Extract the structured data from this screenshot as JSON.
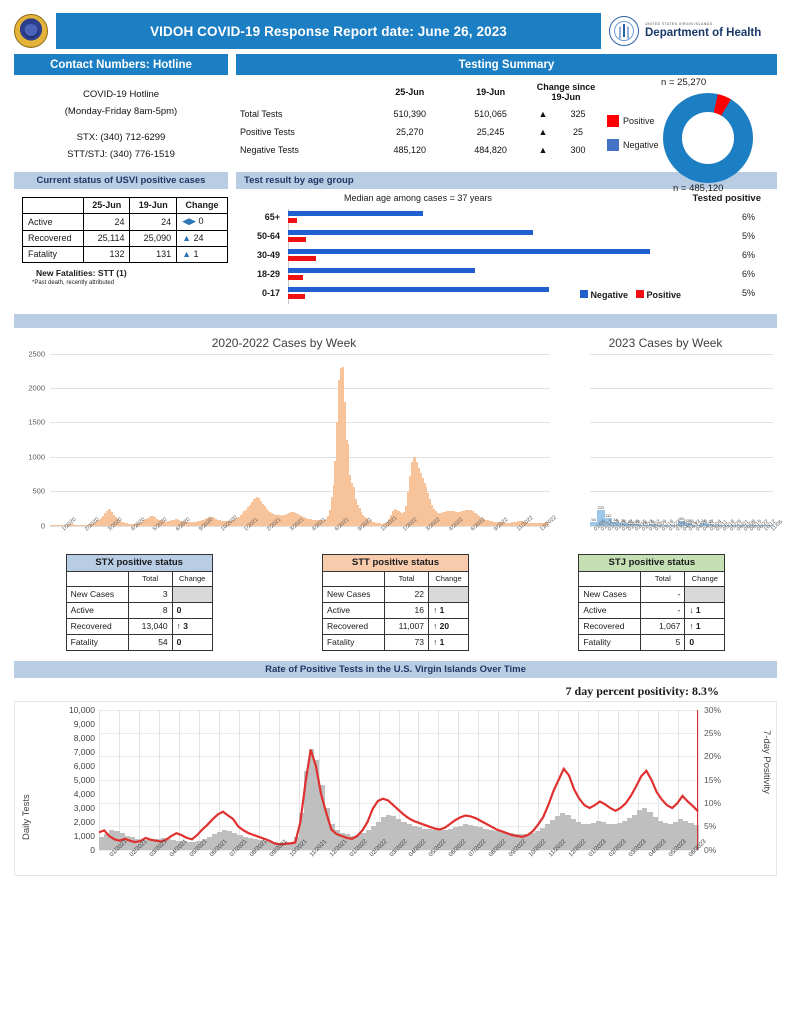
{
  "header": {
    "title": "VIDOH COVID-19 Response Report date: June 26, 2023",
    "logo_small": "UNITED STATES VIRGIN ISLANDS",
    "logo_big": "Department of Health",
    "accent_blue": "#1d7fc3"
  },
  "contact": {
    "heading": "Contact Numbers: Hotline",
    "line1": "COVID-19 Hotline",
    "line2": "(Monday-Friday 8am-5pm)",
    "line3": "STX: (340) 712-6299",
    "line4": "STT/STJ: (340) 776-1519"
  },
  "testing": {
    "heading": "Testing Summary",
    "columns": [
      "",
      "25-Jun",
      "19-Jun",
      "Change since 19-Jun"
    ],
    "rows": [
      {
        "label": "Total Tests",
        "current": "510,390",
        "previous": "510,065",
        "arrow": "▲",
        "change": "325"
      },
      {
        "label": "Positive Tests",
        "current": "25,270",
        "previous": "25,245",
        "arrow": "▲",
        "change": "25"
      },
      {
        "label": "Negative Tests",
        "current": "485,120",
        "previous": "484,820",
        "arrow": "▲",
        "change": "300"
      }
    ],
    "donut": {
      "label_top": "n =  25,270",
      "label_bottom": "n =  485,120",
      "legend": [
        {
          "name": "Positive",
          "color": "#ff0000"
        },
        {
          "name": "Negative",
          "color": "#4472c4"
        }
      ],
      "positive_value": 25270,
      "negative_value": 485120
    }
  },
  "status": {
    "heading": "Current status of USVI positive cases",
    "columns": [
      "",
      "25-Jun",
      "19-Jun",
      "Change"
    ],
    "rows": [
      {
        "label": "Active",
        "current": "24",
        "previous": "24",
        "arrow": "◀▶",
        "change": "0"
      },
      {
        "label": "Recovered",
        "current": "25,114",
        "previous": "25,090",
        "arrow": "▲",
        "change": "24"
      },
      {
        "label": "Fatality",
        "current": "132",
        "previous": "131",
        "arrow": "▲",
        "change": "1"
      }
    ],
    "new_fatalities": "New Fatalities:  STT (1)",
    "footnote": "*Past death, recently attributed"
  },
  "age": {
    "heading": "Test result by age group",
    "median_text": "Median age among cases = 37 years",
    "tested_positive_header": "Tested positive",
    "legend": [
      {
        "name": "Negative",
        "color": "#1f5fd0"
      },
      {
        "name": "Positive",
        "color": "#ee1111"
      }
    ],
    "chart_data": {
      "type": "bar",
      "title": "Test result by age group",
      "categories": [
        "65+",
        "50-64",
        "30-49",
        "18-29",
        "0-17"
      ],
      "series": [
        {
          "name": "Negative",
          "values": [
            88,
            160,
            236,
            122,
            170
          ],
          "color": "#1f5fd0"
        },
        {
          "name": "Positive",
          "values": [
            6,
            12,
            18,
            10,
            11
          ],
          "color": "#ee1111"
        }
      ],
      "tested_positive_pct": [
        "6%",
        "5%",
        "6%",
        "6%",
        "5%"
      ],
      "xlabel": "",
      "ylabel": "",
      "grid": false,
      "legend_position": "bottom-right"
    }
  },
  "weekly_2020_2022": {
    "chart_data": {
      "type": "bar",
      "title": "2020-2022 Cases by Week",
      "xlabel": "",
      "ylabel": "",
      "ylim": [
        0,
        2500
      ],
      "yticks": [
        0,
        500,
        1000,
        1500,
        2000,
        2500
      ],
      "grid": true,
      "color": "#f7c39a",
      "xtick_labels": [
        "1/2020",
        "2/2020",
        "3/2020",
        "4/2020",
        "5/2020",
        "6/2020",
        "9/2020",
        "10/2020",
        "1/2021",
        "2/2021",
        "3/2021",
        "4/2021",
        "6/2021",
        "9/2021",
        "11/2021",
        "1/2022",
        "3/2022",
        "4/2022",
        "6/2022",
        "9/2022",
        "11/2022",
        "12/2022"
      ],
      "values": [
        0,
        0,
        1,
        3,
        2,
        5,
        4,
        6,
        8,
        12,
        18,
        22,
        16,
        12,
        10,
        14,
        11,
        9,
        7,
        10,
        14,
        20,
        26,
        35,
        48,
        62,
        80,
        105,
        140,
        178,
        215,
        240,
        225,
        190,
        150,
        118,
        92,
        70,
        55,
        44,
        38,
        32,
        28,
        25,
        22,
        20,
        24,
        30,
        42,
        58,
        76,
        95,
        112,
        128,
        140,
        132,
        118,
        100,
        86,
        74,
        66,
        60,
        58,
        62,
        70,
        78,
        86,
        92,
        88,
        80,
        72,
        66,
        60,
        56,
        52,
        50,
        48,
        50,
        54,
        60,
        68,
        76,
        84,
        92,
        104,
        118,
        130,
        118,
        104,
        92,
        82,
        76,
        70,
        66,
        62,
        60,
        64,
        72,
        82,
        96,
        112,
        130,
        152,
        178,
        205,
        232,
        268,
        305,
        345,
        380,
        405,
        420,
        398,
        360,
        318,
        278,
        245,
        215,
        192,
        175,
        162,
        155,
        150,
        148,
        145,
        150,
        158,
        168,
        180,
        192,
        200,
        195,
        182,
        165,
        148,
        132,
        118,
        108,
        100,
        94,
        90,
        86,
        84,
        82,
        80,
        78,
        76,
        80,
        95,
        140,
        230,
        420,
        590,
        940,
        1500,
        2120,
        2290,
        2310,
        1800,
        1240,
        1180,
        740,
        620,
        560,
        380,
        300,
        250,
        200,
        160,
        130,
        105,
        85,
        70,
        58,
        48,
        40,
        34,
        30,
        28,
        30,
        40,
        60,
        95,
        150,
        205,
        235,
        228,
        210,
        190,
        175,
        200,
        290,
        480,
        720,
        920,
        995,
        990,
        930,
        840,
        760,
        690,
        620,
        560,
        470,
        380,
        300,
        245,
        210,
        185,
        175,
        180,
        190,
        200,
        210,
        215,
        218,
        215,
        208,
        200,
        198,
        202,
        210,
        218,
        225,
        230,
        228,
        220,
        205,
        185,
        162,
        140,
        120,
        104,
        92,
        82,
        74,
        68,
        62,
        58,
        54,
        50,
        48,
        46,
        44,
        42,
        40,
        40,
        42,
        46,
        52,
        58,
        64,
        68,
        66,
        60,
        52,
        45,
        40,
        36,
        34,
        32,
        30,
        30,
        32,
        36,
        42,
        48,
        52
      ]
    }
  },
  "weekly_2023": {
    "chart_data": {
      "type": "bar",
      "title": "2023 Cases by Week",
      "xlabel": "",
      "ylabel": "",
      "ylim": [
        0,
        2500
      ],
      "grid": true,
      "color": "#9ec6e8",
      "xtick_labels": [
        "01/05",
        "01/12",
        "01/19",
        "01/26",
        "02/02",
        "02/09",
        "02/16",
        "02/23",
        "03/02",
        "03/09",
        "03/16",
        "03/23",
        "03/30",
        "04/06",
        "04/13",
        "04/20",
        "04/27",
        "05/04",
        "05/11",
        "05/18",
        "05/25",
        "06/01",
        "06/08",
        "06/15",
        "06/22",
        "10/12",
        "11/06"
      ],
      "values": [
        54,
        222,
        112,
        44,
        36,
        20,
        22,
        12,
        19,
        10,
        8,
        9,
        65,
        35,
        8,
        34,
        20,
        12,
        10,
        8,
        9,
        7,
        6,
        5,
        4
      ],
      "data_labels": [
        "54",
        "222",
        "112",
        "44",
        "36",
        "20",
        "22",
        "12",
        "19",
        "",
        "",
        "",
        "65",
        "35",
        "8",
        "34",
        "20",
        "",
        "",
        "",
        "",
        "",
        "",
        "",
        ""
      ]
    }
  },
  "islands": [
    {
      "name": "STX positive status",
      "accent": "#b8cce4",
      "columns": [
        "",
        "Total",
        "Change"
      ],
      "rows": [
        {
          "label": "New Cases",
          "total": "3",
          "change": "",
          "arrow": ""
        },
        {
          "label": "Active",
          "total": "8",
          "change": "0",
          "arrow": ""
        },
        {
          "label": "Recovered",
          "total": "13,040",
          "change": "3",
          "arrow": "↑"
        },
        {
          "label": "Fatality",
          "total": "54",
          "change": "0",
          "arrow": ""
        }
      ]
    },
    {
      "name": "STT positive status",
      "accent": "#f8cbad",
      "columns": [
        "",
        "Total",
        "Change"
      ],
      "rows": [
        {
          "label": "New Cases",
          "total": "22",
          "change": "",
          "arrow": ""
        },
        {
          "label": "Active",
          "total": "16",
          "change": "1",
          "arrow": "↑"
        },
        {
          "label": "Recovered",
          "total": "11,007",
          "change": "20",
          "arrow": "↑"
        },
        {
          "label": "Fatality",
          "total": "73",
          "change": "1",
          "arrow": "↑"
        }
      ]
    },
    {
      "name": "STJ positive status",
      "accent": "#c5e0b4",
      "columns": [
        "",
        "Total",
        "Change"
      ],
      "rows": [
        {
          "label": "New Cases",
          "total": "-",
          "change": "",
          "arrow": ""
        },
        {
          "label": "Active",
          "total": "-",
          "change": "1",
          "arrow": "↓"
        },
        {
          "label": "Recovered",
          "total": "1,067",
          "change": "1",
          "arrow": "↑"
        },
        {
          "label": "Fatality",
          "total": "5",
          "change": "0",
          "arrow": ""
        }
      ]
    }
  ],
  "positivity": {
    "heading": "Rate of Positive Tests in the U.S. Virgin Islands Over Time",
    "seven_day_label": "7 day percent positivity:  8.3%",
    "chart_data": {
      "type": "line",
      "title": "Rate of Positive Tests in the U.S. Virgin Islands Over Time",
      "ylabel": "Daily Tests",
      "y2label": "7-day Positivity",
      "ylim": [
        0,
        10000
      ],
      "yticks": [
        "0",
        "1,000",
        "2,000",
        "3,000",
        "4,000",
        "5,000",
        "6,000",
        "7,000",
        "8,000",
        "9,000",
        "10,000"
      ],
      "y2lim": [
        0,
        30
      ],
      "y2ticks": [
        "0%",
        "5%",
        "10%",
        "15%",
        "20%",
        "25%",
        "30%"
      ],
      "grid": true,
      "line_color": "#e03131",
      "bar_color": "#bfbfbf",
      "xtick_labels": [
        "01/2021",
        "02/2021",
        "03/2021",
        "04/2021",
        "05/2021",
        "06/2021",
        "07/2021",
        "08/2021",
        "09/2021",
        "10/2021",
        "11/2021",
        "12/2021",
        "01/2022",
        "02/2022",
        "03/2022",
        "04/2022",
        "05/2022",
        "06/2022",
        "07/2022",
        "08/2022",
        "09/2022",
        "10/2022",
        "11/2022",
        "12/2022",
        "01/2023",
        "02/2023",
        "03/2023",
        "04/2023",
        "05/2023",
        "06/2023"
      ],
      "series": [
        {
          "name": "7-day Positivity",
          "unit": "percent",
          "values": [
            3.8,
            4.2,
            3.0,
            2.3,
            2.0,
            2.4,
            2.0,
            1.7,
            1.9,
            2.6,
            2.2,
            2.0,
            1.8,
            2.2,
            3.0,
            3.6,
            3.2,
            2.6,
            2.3,
            3.2,
            4.4,
            5.4,
            6.6,
            7.6,
            8.2,
            7.4,
            6.6,
            5.0,
            4.2,
            3.6,
            3.2,
            2.8,
            2.4,
            2.0,
            1.4,
            1.2,
            1.3,
            1.4,
            1.6,
            6.0,
            14.5,
            21.5,
            18.0,
            12.0,
            8.0,
            4.4,
            3.4,
            3.0,
            2.6,
            2.4,
            3.0,
            4.2,
            6.0,
            8.8,
            10.5,
            11.0,
            10.6,
            9.6,
            8.6,
            7.6,
            6.8,
            6.2,
            5.8,
            5.4,
            5.0,
            4.6,
            4.4,
            4.8,
            5.6,
            6.4,
            7.0,
            7.4,
            7.2,
            6.8,
            6.2,
            5.6,
            5.0,
            4.4,
            4.0,
            3.6,
            3.2,
            3.0,
            2.8,
            3.2,
            4.0,
            5.4,
            7.0,
            9.6,
            12.6,
            15.0,
            17.4,
            16.0,
            13.0,
            11.0,
            9.6,
            9.0,
            9.6,
            10.4,
            9.8,
            9.0,
            8.4,
            9.0,
            10.0,
            11.6,
            13.6,
            15.8,
            17.0,
            15.0,
            12.4,
            10.8,
            9.6,
            9.0,
            10.0,
            11.6,
            10.4,
            9.4,
            8.3
          ]
        },
        {
          "name": "Daily Tests",
          "unit": "tests",
          "peak_value": 7200,
          "values": [
            900,
            1100,
            1400,
            1300,
            1150,
            980,
            880,
            760,
            700,
            660,
            700,
            780,
            820,
            760,
            700,
            640,
            600,
            560,
            540,
            620,
            760,
            920,
            1080,
            1240,
            1380,
            1300,
            1180,
            1020,
            900,
            820,
            760,
            700,
            640,
            580,
            540,
            500,
            520,
            560,
            900,
            2600,
            5600,
            7200,
            6400,
            4600,
            3000,
            1800,
            1400,
            1200,
            1100,
            1000,
            1050,
            1200,
            1400,
            1700,
            2000,
            2300,
            2500,
            2400,
            2200,
            2000,
            1800,
            1700,
            1600,
            1500,
            1450,
            1400,
            1380,
            1420,
            1500,
            1600,
            1700,
            1800,
            1780,
            1700,
            1600,
            1500,
            1400,
            1300,
            1250,
            1200,
            1150,
            1100,
            1080,
            1120,
            1200,
            1350,
            1550,
            1800,
            2100,
            2400,
            2600,
            2500,
            2200,
            2000,
            1850,
            1800,
            1900,
            2050,
            1950,
            1850,
            1800,
            1900,
            2050,
            2250,
            2500,
            2800,
            3000,
            2700,
            2300,
            2050,
            1900,
            1800,
            1950,
            2200,
            2050,
            1900,
            1750
          ]
        }
      ]
    }
  }
}
